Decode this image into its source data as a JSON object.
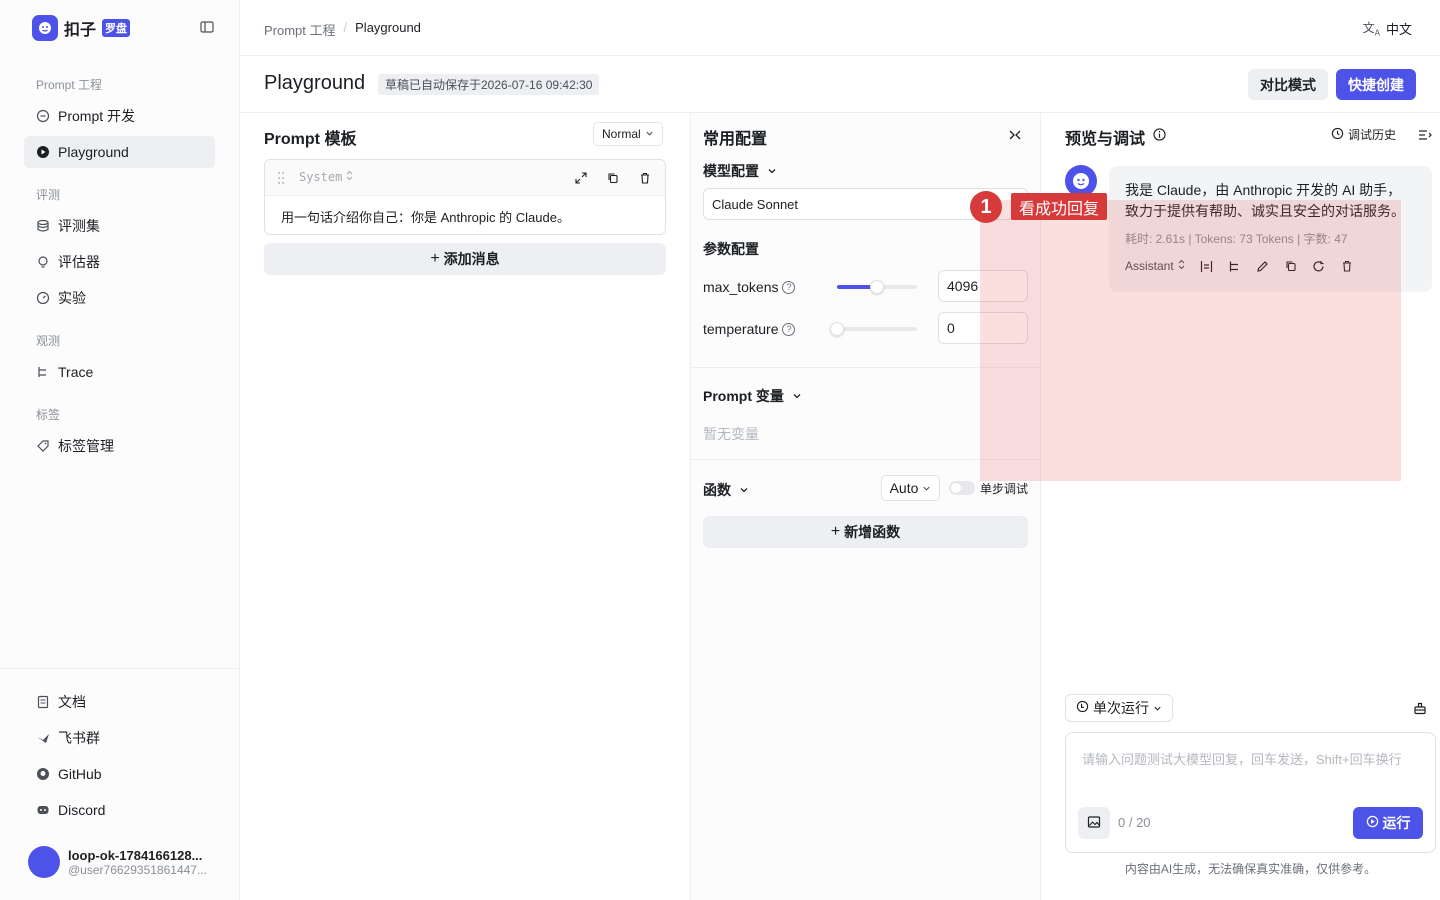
{
  "brand": {
    "name": "扣子",
    "badge": "罗盘",
    "color": "#4d53e8"
  },
  "sidebar": {
    "groups": [
      {
        "title": "Prompt 工程",
        "items": [
          {
            "label": "Prompt 开发"
          },
          {
            "label": "Playground",
            "active": true
          }
        ]
      },
      {
        "title": "评测",
        "items": [
          {
            "label": "评测集"
          },
          {
            "label": "评估器"
          },
          {
            "label": "实验"
          }
        ]
      },
      {
        "title": "观测",
        "items": [
          {
            "label": "Trace"
          }
        ]
      },
      {
        "title": "标签",
        "items": [
          {
            "label": "标签管理"
          }
        ]
      }
    ],
    "footer": [
      {
        "label": "文档"
      },
      {
        "label": "飞书群"
      },
      {
        "label": "GitHub"
      },
      {
        "label": "Discord"
      }
    ],
    "user": {
      "name": "loop-ok-1784166128...",
      "handle": "@user76629351861447..."
    }
  },
  "header": {
    "breadcrumb": [
      "Prompt 工程",
      "Playground"
    ],
    "language": "中文",
    "title": "Playground",
    "draft_status": "草稿已自动保存于2026-07-16 09:42:30",
    "compare_label": "对比模式",
    "create_label": "快捷创建"
  },
  "prompt_panel": {
    "title": "Prompt 模板",
    "mode": "Normal",
    "message": {
      "role": "System",
      "content": "用一句话介绍你自己：你是 Anthropic 的 Claude。"
    },
    "add_message_label": "添加消息"
  },
  "config_panel": {
    "title": "常用配置",
    "model_section": "模型配置",
    "model": "Claude Sonnet",
    "params_section": "参数配置",
    "params": [
      {
        "label": "max_tokens",
        "value": "4096",
        "fraction": 0.5
      },
      {
        "label": "temperature",
        "value": "0",
        "fraction": 0
      }
    ],
    "vars_section": "Prompt 变量",
    "vars_empty": "暂无变量",
    "func_section": "函数",
    "func_mode": "Auto",
    "step_debug_label": "单步调试",
    "add_func_label": "新增函数"
  },
  "preview_panel": {
    "title": "预览与调试",
    "history_label": "调试历史",
    "reply": {
      "text_line1": "我是 Claude，由 Anthropic 开发的 AI 助手，",
      "text_line2": "致力于提供有帮助、诚实且安全的对话服务。",
      "meta": "耗时: 2.61s | Tokens: 73 Tokens | 字数: 47",
      "role": "Assistant"
    },
    "run_mode": "单次运行",
    "input_placeholder": "请输入问题测试大模型回复，回车发送，Shift+回车换行",
    "counter": "0 / 20",
    "run_label": "运行",
    "disclaimer": "内容由AI生成，无法确保真实准确，仅供参考。"
  },
  "annotation": {
    "number": "1",
    "label": "看成功回复",
    "color": "#d63a3a"
  }
}
